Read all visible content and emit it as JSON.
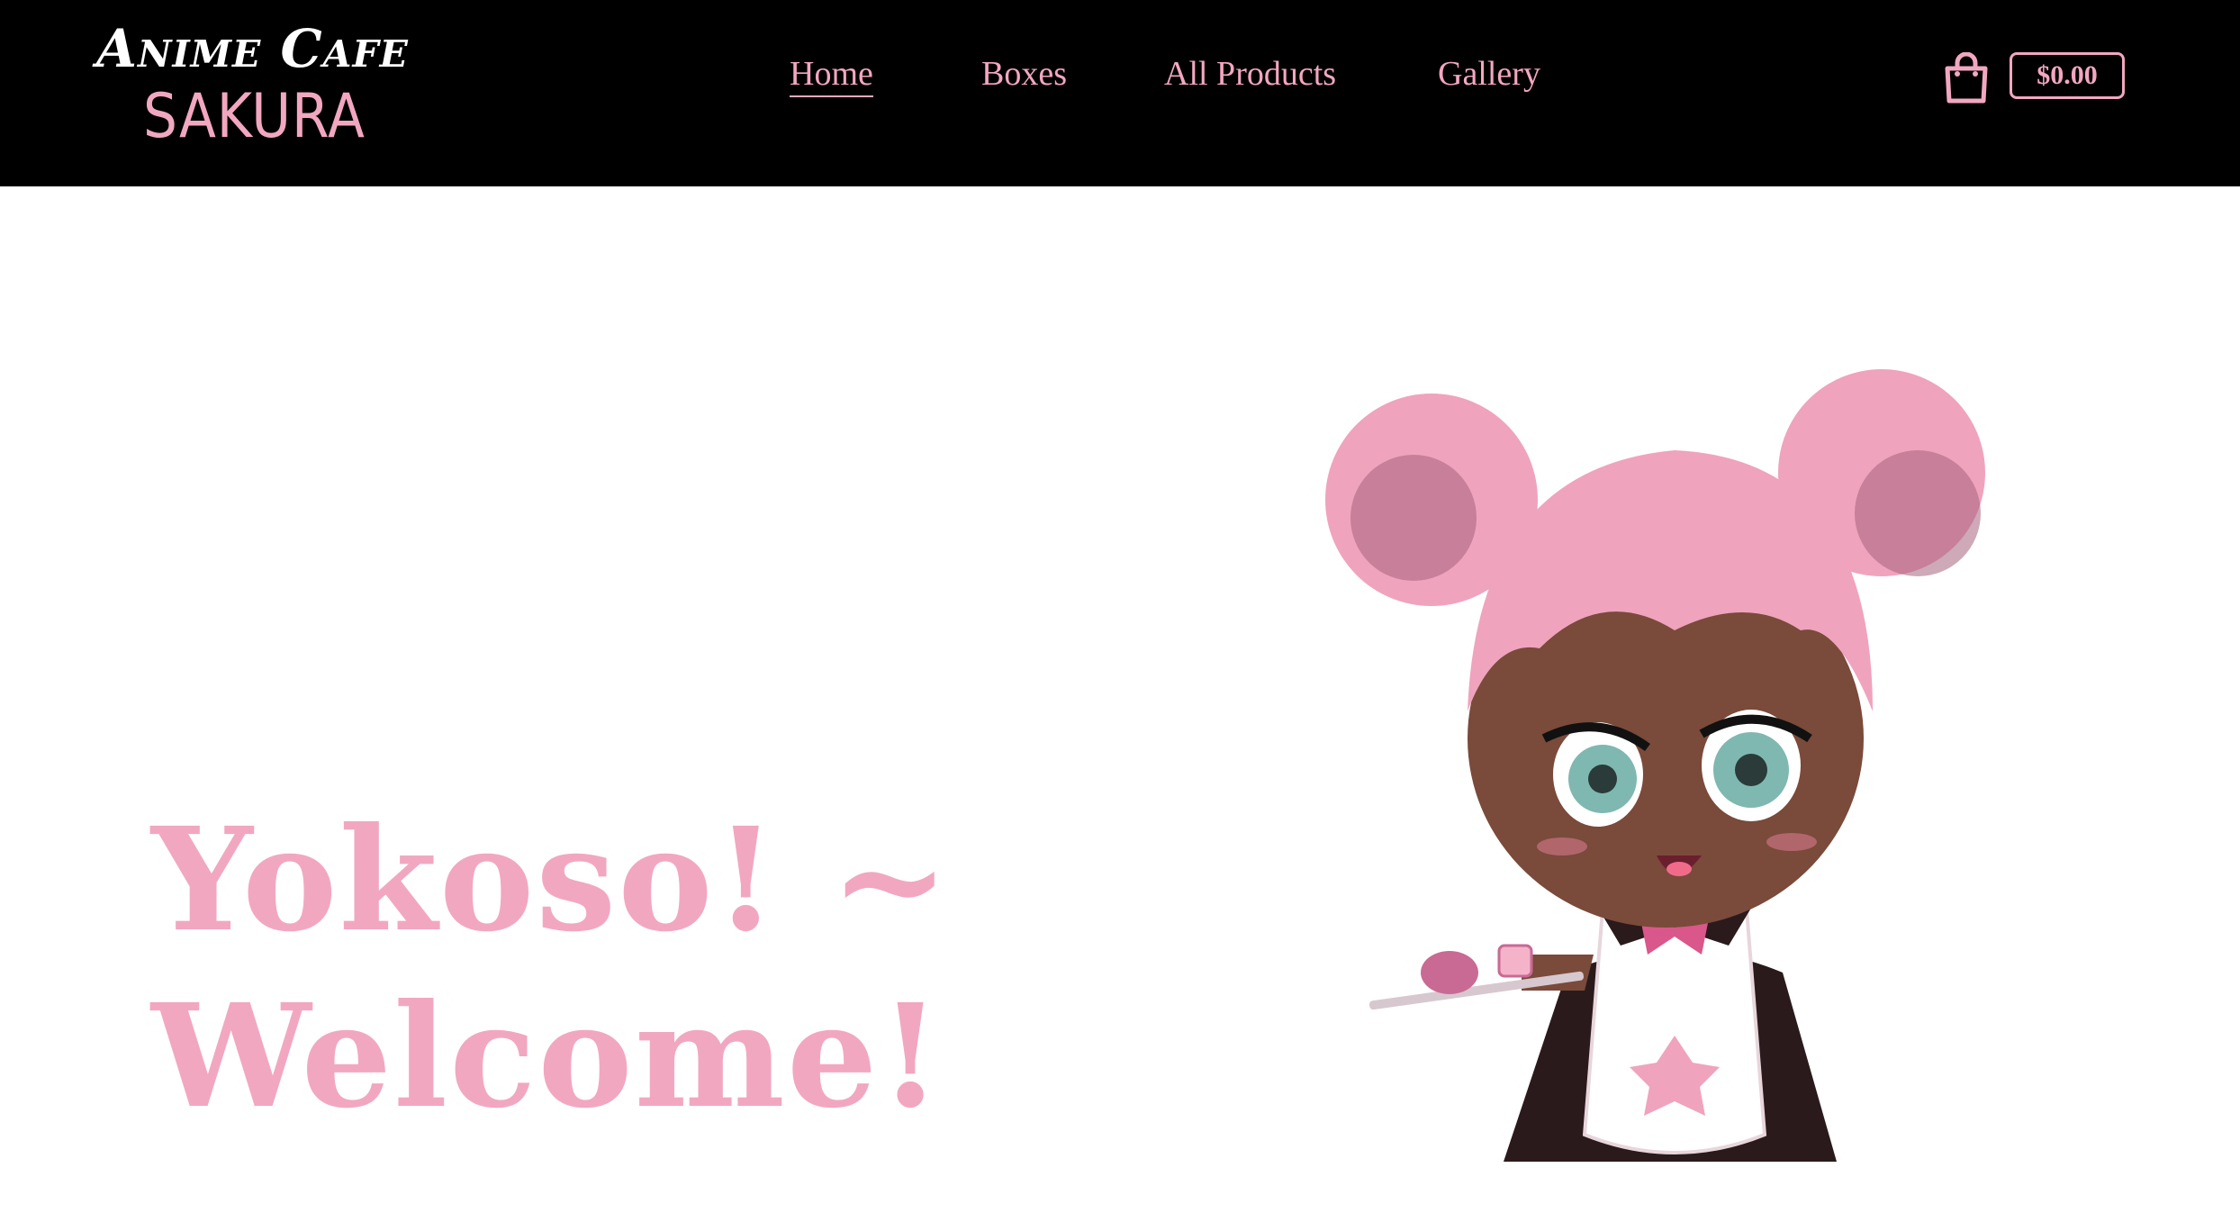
{
  "brand": {
    "line1": "Anime Cafe",
    "line2": "SAKURA",
    "accent_color": "#f2a7c0",
    "header_bg": "#000000"
  },
  "nav": {
    "items": [
      {
        "label": "Home",
        "active": true
      },
      {
        "label": "Boxes",
        "active": false
      },
      {
        "label": "All Products",
        "active": false
      },
      {
        "label": "Gallery",
        "active": false
      }
    ]
  },
  "cart": {
    "icon": "shopping-bag-icon",
    "total": "$0.00"
  },
  "hero": {
    "title_line1": "Yokoso! ~",
    "title_line2": "Welcome!",
    "image": "anime-maid-mascot-illustration"
  }
}
